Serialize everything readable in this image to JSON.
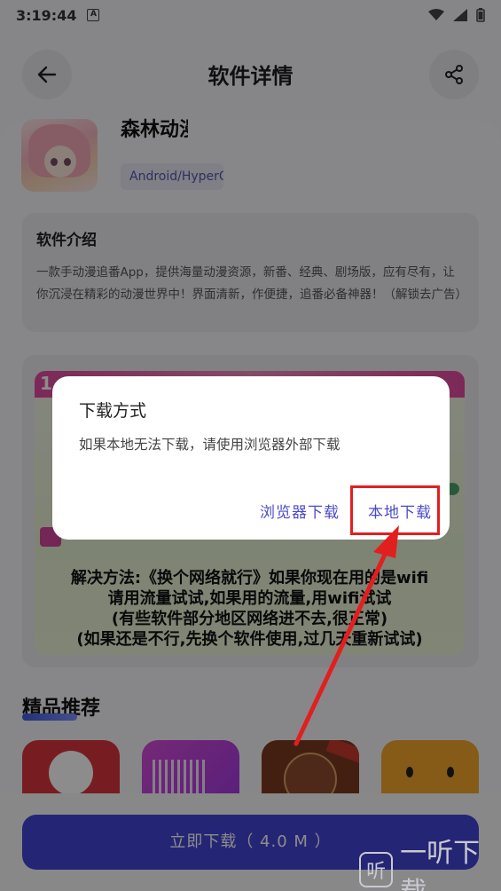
{
  "status_bar": {
    "time": "3:19:44",
    "notif_icon": "A"
  },
  "header": {
    "title": "软件详情"
  },
  "app": {
    "name": "森林动漫",
    "platform": "Android/HyperOS"
  },
  "intro": {
    "title": "软件介绍",
    "text": "一款手动漫追番App，提供海量动漫资源，新番、经典、剧场版，应有尽有，让你沉浸在精彩的动漫世界中！界面清新，作便捷，追番必备神器！（解锁去广告）"
  },
  "screenshot": {
    "banner_num": "1",
    "lines": [
      "解决方法:《换个网络就行》如果你现在用的是wifi",
      "请用流量试试,如果用的流量,用wifi试试",
      "(有些软件部分地区网络进不去,很正常)",
      "(如果还是不行,先换个软件使用,过几天重新试试)"
    ]
  },
  "recommend": {
    "title": "精品推荐"
  },
  "download": {
    "label": "立即下载（ 4.0 M ）"
  },
  "dialog": {
    "title": "下载方式",
    "message": "如果本地无法下载，请使用浏览器外部下载",
    "browser_btn": "浏览器下载",
    "local_btn": "本地下载"
  },
  "watermark": {
    "logo": "听",
    "text": "一听下载"
  },
  "colors": {
    "accent": "#4444d6",
    "highlight": "#e21f1f"
  }
}
